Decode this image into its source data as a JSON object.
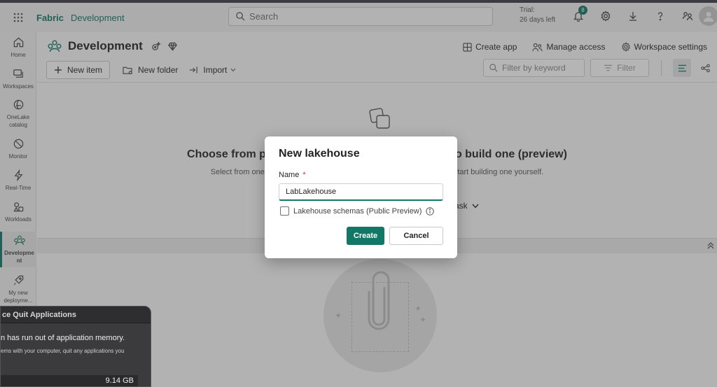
{
  "topbar": {
    "brand": "Fabric",
    "workspace": "Development",
    "search_placeholder": "Search",
    "trial_line1": "Trial:",
    "trial_line2": "26 days left",
    "notification_count": "8",
    "icons": [
      "app-launcher-icon",
      "bell-icon",
      "gear-icon",
      "download-icon",
      "help-icon",
      "share-icon",
      "avatar"
    ]
  },
  "sidenav": {
    "items": [
      {
        "label": "Home",
        "icon": "home-icon"
      },
      {
        "label": "Workspaces",
        "icon": "workspaces-icon"
      },
      {
        "label_line1": "OneLake",
        "label_line2": "catalog",
        "icon": "onelake-icon"
      },
      {
        "label": "Monitor",
        "icon": "monitor-icon"
      },
      {
        "label": "Real-Time",
        "icon": "lightning-icon"
      },
      {
        "label": "Workloads",
        "icon": "workloads-icon"
      },
      {
        "label_line1": "Developme",
        "label_line2": "nt",
        "icon": "workspace-icon",
        "active": true
      },
      {
        "label_line1": "My new",
        "label_line2": "deployme...",
        "icon": "rocket-icon"
      }
    ]
  },
  "workspace": {
    "title": "Development",
    "actions": {
      "create_app": "Create app",
      "manage_access": "Manage access",
      "workspace_settings": "Workspace settings"
    },
    "toolbar": {
      "new_item": "New item",
      "new_folder": "New folder",
      "import": "Import"
    },
    "filter_placeholder": "Filter by keyword",
    "filter_label": "Filter"
  },
  "empty_state": {
    "title_left": "Choose from p",
    "title_right": "o build one (preview)",
    "sub_left": "Select from one",
    "sub_right": "start building one yourself.",
    "task_link": "ask"
  },
  "dialog": {
    "title": "New lakehouse",
    "name_label": "Name",
    "required_mark": "*",
    "name_value": "LabLakehouse",
    "schemas_label": "Lakehouse schemas (Public Preview)",
    "schemas_checked": false,
    "create_label": "Create",
    "cancel_label": "Cancel"
  },
  "mac_window": {
    "title": "ce Quit Applications",
    "message": "n has run out of application memory.",
    "sub": "ems with your computer, quit any applications you",
    "memory": "9.14 GB"
  },
  "colors": {
    "accent": "#117865",
    "overlay": "rgba(60,60,60,0.38)"
  }
}
